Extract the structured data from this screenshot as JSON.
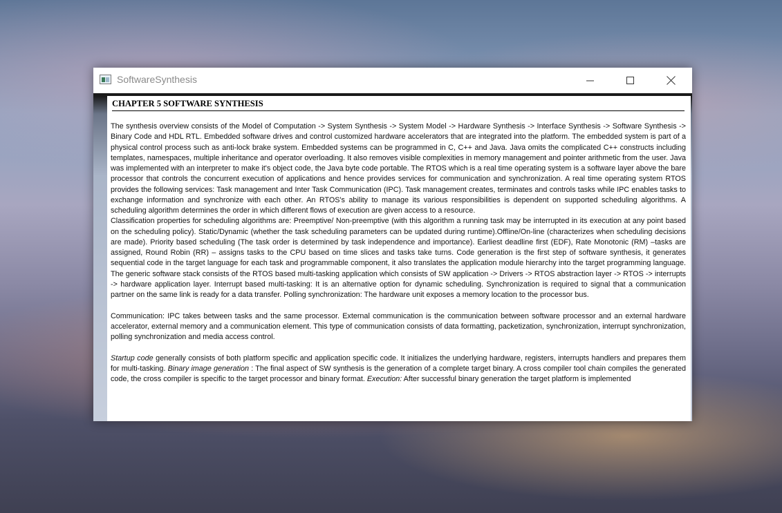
{
  "window": {
    "title": "SoftwareSynthesis"
  },
  "document": {
    "heading": "CHAPTER 5 SOFTWARE SYNTHESIS",
    "paragraph1": "The synthesis overview consists of the Model of Computation -> System Synthesis -> System Model -> Hardware Synthesis -> Interface Synthesis -> Software Synthesis -> Binary Code and HDL RTL. Embedded software drives and control customized hardware accelerators that are integrated into the platform.   The embedded system is part of a physical control process such as anti-lock brake system.   Embedded systems can be programmed in C, C++ and Java.  Java omits the complicated C++ constructs including templates, namespaces, multiple inheritance and operator overloading. It also removes visible complexities in memory management and pointer arithmetic from the user.  Java was implemented with an interpreter to make it's object code, the Java byte code portable.  The RTOS which is a real time operating system is a software layer above the bare processor that controls the concurrent execution of applications and hence provides services for communication and synchronization.  A real time operating system  RTOS provides the following services:  Task management and Inter Task Communication (IPC). Task management creates, terminates and controls tasks while IPC enables tasks to exchange information and synchronize with each other.  An RTOS's ability to manage its various responsibilities is dependent on supported scheduling algorithms.  A scheduling algorithm determines the order in which different flows of execution are given access to a resource.",
    "paragraph2": "Classification properties for scheduling algorithms are: Preemptive/ Non-preemptive  (with this algorithm a running task may be interrupted in its execution at any point based on the scheduling policy). Static/Dynamic (whether the task scheduling parameters can be updated during runtime).Offline/On-line (characterizes when scheduling decisions are made). Priority based scheduling (The task order is determined by task independence and importance). Earliest deadline first (EDF), Rate Monotonic (RM) –tasks are assigned, Round Robin (RR) –  assigns tasks to the CPU based on time slices and tasks take turns.  Code generation is the first step of software synthesis, it generates sequential code in the target language for each task and programmable component, it also translates the application module hierarchy into the target programming language.   The generic software stack consists of the RTOS based multi-tasking application which  consists of SW application -> Drivers -> RTOS abstraction layer -> RTOS -> interrupts -> hardware application layer.   Interrupt based multi-tasking: It is an alternative option for dynamic scheduling.      Synchronization is required to signal that a communication partner on the same link is ready for a data transfer.  Polling synchronization:   The hardware unit exposes a memory location to the processor bus.",
    "paragraph3": "Communication:    IPC takes between tasks and the same processor. External communication is the communication between software processor and an external hardware accelerator, external memory and a communication element.  This type of communication consists of data formatting, packetization, synchronization, interrupt synchronization, polling synchronization and media access control.",
    "paragraph4": {
      "startup_label": "Startup code",
      "startup_text": "  generally consists of both platform specific and application specific code. It initializes the underlying hardware, registers, interrupts handlers and prepares them for multi-tasking.    ",
      "binary_label": "Binary image generation",
      "binary_text": " : The final aspect of SW synthesis is the generation of a complete target binary. A cross compiler tool chain compiles the generated code, the cross compiler is specific to the target processor and binary format.  ",
      "execution_label": "Execution:",
      "execution_text": "   After successful binary generation the target platform is implemented"
    }
  },
  "icons": {
    "app": "app-window-icon",
    "minimize": "minimize-icon",
    "maximize": "maximize-icon",
    "close": "close-icon"
  }
}
